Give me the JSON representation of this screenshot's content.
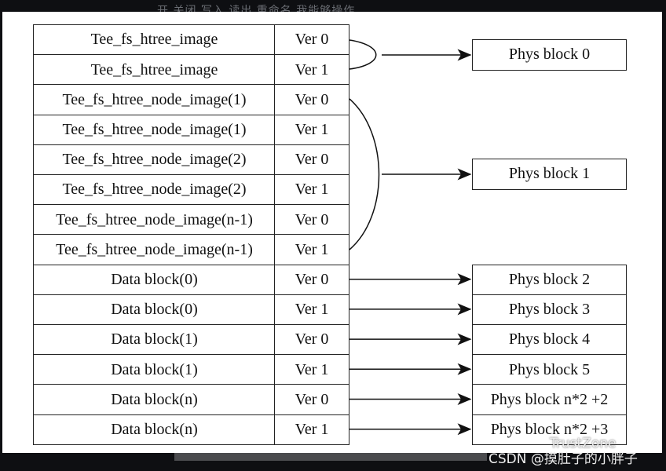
{
  "background_text": "开 关闭 写入 读出 重命名 我能够操作",
  "rows": [
    {
      "name": "Tee_fs_htree_image",
      "ver": "Ver 0"
    },
    {
      "name": "Tee_fs_htree_image",
      "ver": "Ver 1"
    },
    {
      "name": "Tee_fs_htree_node_image(1)",
      "ver": "Ver 0"
    },
    {
      "name": "Tee_fs_htree_node_image(1)",
      "ver": "Ver 1"
    },
    {
      "name": "Tee_fs_htree_node_image(2)",
      "ver": "Ver 0"
    },
    {
      "name": "Tee_fs_htree_node_image(2)",
      "ver": "Ver 1"
    },
    {
      "name": "Tee_fs_htree_node_image(n-1)",
      "ver": "Ver 0"
    },
    {
      "name": "Tee_fs_htree_node_image(n-1)",
      "ver": "Ver 1"
    },
    {
      "name": "Data block(0)",
      "ver": "Ver 0"
    },
    {
      "name": "Data block(0)",
      "ver": "Ver 1"
    },
    {
      "name": "Data block(1)",
      "ver": "Ver 0"
    },
    {
      "name": "Data block(1)",
      "ver": "Ver 1"
    },
    {
      "name": "Data block(n)",
      "ver": "Ver 0"
    },
    {
      "name": "Data block(n)",
      "ver": "Ver 1"
    }
  ],
  "phys_blocks": [
    "Phys block 0",
    "Phys block 1",
    "Phys block 2",
    "Phys block 3",
    "Phys block 4",
    "Phys block 5",
    "Phys block n*2 +2",
    "Phys block n*2 +3"
  ],
  "watermark": {
    "brand": "TrustZone",
    "author": "CSDN @摸肚子的小胖子"
  }
}
